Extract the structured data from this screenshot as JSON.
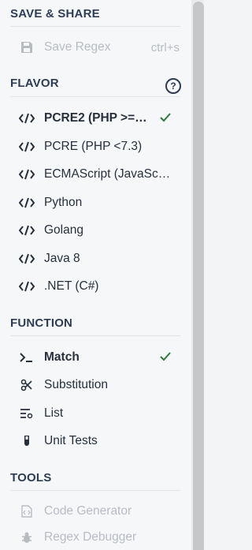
{
  "sections": {
    "save_share": {
      "title": "SAVE & SHARE",
      "items": [
        {
          "label": "Save Regex",
          "shortcut": "ctrl+s",
          "icon": "save-icon",
          "disabled": true
        }
      ]
    },
    "flavor": {
      "title": "FLAVOR",
      "help_icon": "?",
      "items": [
        {
          "label": "PCRE2 (PHP >=…",
          "selected": true,
          "icon": "code-icon"
        },
        {
          "label": "PCRE (PHP <7.3)",
          "icon": "code-icon"
        },
        {
          "label": "ECMAScript (JavaSc…",
          "icon": "code-icon"
        },
        {
          "label": "Python",
          "icon": "code-icon"
        },
        {
          "label": "Golang",
          "icon": "code-icon"
        },
        {
          "label": "Java 8",
          "icon": "code-icon"
        },
        {
          "label": ".NET (C#)",
          "icon": "code-icon"
        }
      ]
    },
    "function": {
      "title": "FUNCTION",
      "items": [
        {
          "label": "Match",
          "selected": true,
          "icon": "terminal-icon"
        },
        {
          "label": "Substitution",
          "icon": "scissors-icon"
        },
        {
          "label": "List",
          "icon": "list-settings-icon"
        },
        {
          "label": "Unit Tests",
          "icon": "test-tube-icon"
        }
      ]
    },
    "tools": {
      "title": "TOOLS",
      "items": [
        {
          "label": "Code Generator",
          "icon": "code-file-icon",
          "disabled": true
        },
        {
          "label": "Regex Debugger",
          "icon": "bug-icon",
          "disabled": true
        }
      ]
    }
  },
  "colors": {
    "accent_check": "#2f7a3b",
    "section_title": "#2d3d55",
    "disabled_text": "#b7bcc3"
  }
}
